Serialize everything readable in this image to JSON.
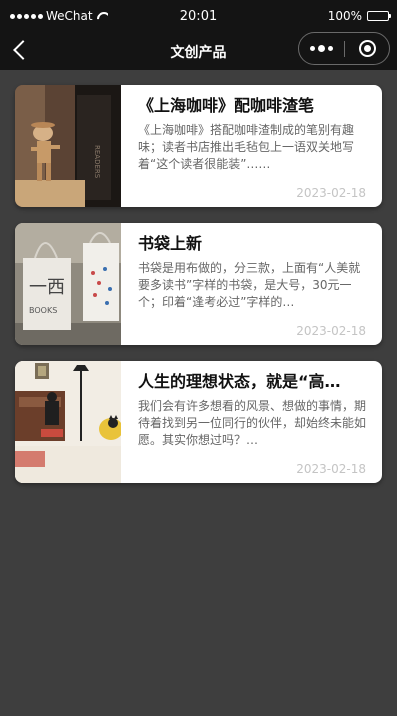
{
  "status_bar": {
    "carrier": "WeChat",
    "time": "20:01",
    "battery": "100%"
  },
  "navbar": {
    "title": "文创产品"
  },
  "articles": [
    {
      "title": "《上海咖啡》配咖啡渣笔",
      "description": "《上海咖啡》搭配咖啡渣制成的笔别有趣味；读者书店推出毛毡包上一语双关地写着“这个读者很能装”……",
      "date": "2023-02-18"
    },
    {
      "title": "书袋上新",
      "description": "书袋是用布做的，分三款，上面有“人美就要多读书”字样的书袋，是大号，30元一个；印着“逢考必过”字样的…",
      "date": "2023-02-18"
    },
    {
      "title": "人生的理想状态，就是“高…",
      "description": "我们会有许多想看的风景、想做的事情，期待着找到另一位同行的伙伴，却始终未能如愿。其实你想过吗？…",
      "date": "2023-02-18"
    }
  ]
}
